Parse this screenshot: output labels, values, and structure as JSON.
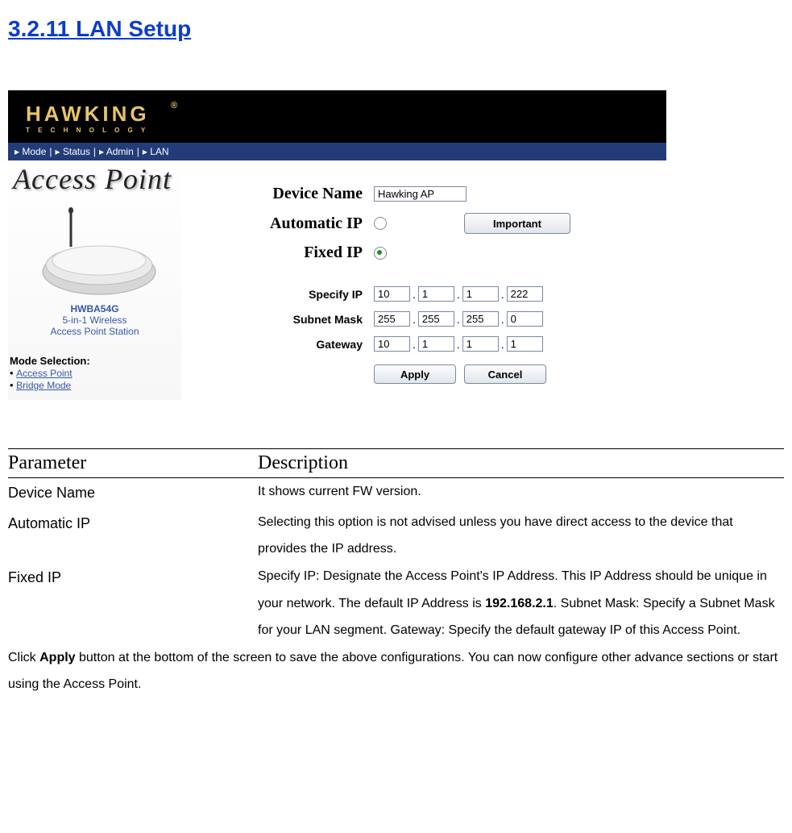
{
  "heading": "3.2.11   LAN Setup",
  "logo": {
    "brand": "HAWKING",
    "tagline": "T E C H N O L O G Y",
    "reg": "®"
  },
  "nav": {
    "items": [
      "Mode",
      "Status",
      "Admin",
      "LAN"
    ]
  },
  "side": {
    "title": "Access Point",
    "model": "HWBA54G",
    "caption_line1": "5-in-1 Wireless",
    "caption_line2": "Access Point Station",
    "mode_title": "Mode Selection:",
    "mode_links": [
      "Access Point",
      "Bridge Mode"
    ]
  },
  "form": {
    "device_name_label": "Device Name",
    "device_name_value": "Hawking AP",
    "automatic_ip_label": "Automatic IP",
    "automatic_ip_selected": false,
    "important_btn": "Important",
    "fixed_ip_label": "Fixed IP",
    "fixed_ip_selected": true,
    "specify_ip_label": "Specify IP",
    "specify_ip": [
      "10",
      "1",
      "1",
      "222"
    ],
    "subnet_label": "Subnet Mask",
    "subnet": [
      "255",
      "255",
      "255",
      "0"
    ],
    "gateway_label": "Gateway",
    "gateway": [
      "10",
      "1",
      "1",
      "1"
    ],
    "apply_btn": "Apply",
    "cancel_btn": "Cancel"
  },
  "table": {
    "header1": "Parameter",
    "header2": "Description",
    "rows": [
      {
        "p": "Device Name",
        "d": "It shows current FW version."
      },
      {
        "p": "Automatic IP",
        "d": "Selecting this option is not advised unless you have direct access to the device that provides the IP address."
      },
      {
        "p": "Fixed IP",
        "d": "Specify IP: Designate the Access Point's IP Address. This IP Address should be unique in your network. The default IP Address is "
      }
    ],
    "default_ip_bold": "192.168.2.1",
    "fixed_ip_tail1": ". Subnet Mask: ",
    "fixed_ip_tail_span": "Specify a Subnet Mask for your LAN segment.",
    "fixed_ip_tail2": "  Gateway: Specify the default gateway IP of this Access Point."
  },
  "footnote": {
    "part1": "Click ",
    "bold": "Apply",
    "part2": " button at the bottom of the screen to save the above configurations. You can now configure other advance sections or start using the Access Point."
  }
}
